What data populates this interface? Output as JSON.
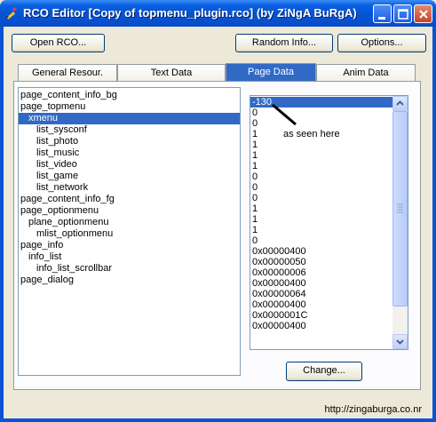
{
  "window": {
    "title": "RCO Editor [Copy of topmenu_plugin.rco] (by ZiNgA BuRgA)"
  },
  "toolbar": {
    "open_label": "Open RCO...",
    "random_info_label": "Random Info...",
    "options_label": "Options..."
  },
  "tabs": [
    {
      "label": "General Resour."
    },
    {
      "label": "Text Data"
    },
    {
      "label": "Page Data"
    },
    {
      "label": "Anim Data"
    }
  ],
  "tree": {
    "items": [
      {
        "label": "page_content_info_bg"
      },
      {
        "label": "page_topmenu"
      },
      {
        "label": "xmenu"
      },
      {
        "label": "list_sysconf"
      },
      {
        "label": "list_photo"
      },
      {
        "label": "list_music"
      },
      {
        "label": "list_video"
      },
      {
        "label": "list_game"
      },
      {
        "label": "list_network"
      },
      {
        "label": "page_content_info_fg"
      },
      {
        "label": "page_optionmenu"
      },
      {
        "label": "plane_optionmenu"
      },
      {
        "label": "mlist_optionmenu"
      },
      {
        "label": "page_info"
      },
      {
        "label": "info_list"
      },
      {
        "label": "info_list_scrollbar"
      },
      {
        "label": "page_dialog"
      }
    ]
  },
  "values": {
    "items": [
      {
        "label": "-130"
      },
      {
        "label": "0"
      },
      {
        "label": "0"
      },
      {
        "label": "1"
      },
      {
        "label": "1"
      },
      {
        "label": "1"
      },
      {
        "label": "1"
      },
      {
        "label": "0"
      },
      {
        "label": "0"
      },
      {
        "label": "0"
      },
      {
        "label": "1"
      },
      {
        "label": "1"
      },
      {
        "label": "1"
      },
      {
        "label": "0"
      },
      {
        "label": "0x00000400"
      },
      {
        "label": "0x00000050"
      },
      {
        "label": "0x00000006"
      },
      {
        "label": "0x00000400"
      },
      {
        "label": "0x00000064"
      },
      {
        "label": "0x00000400"
      },
      {
        "label": "0x0000001C"
      },
      {
        "label": "0x00000400"
      }
    ]
  },
  "annotation": {
    "text": "as seen here"
  },
  "change_label": "Change...",
  "status": {
    "url": "http://zingaburga.co.nr"
  },
  "colors": {
    "selection": "#316ac5",
    "titlebar": "#0453d4",
    "window_bg": "#ece9d8"
  }
}
